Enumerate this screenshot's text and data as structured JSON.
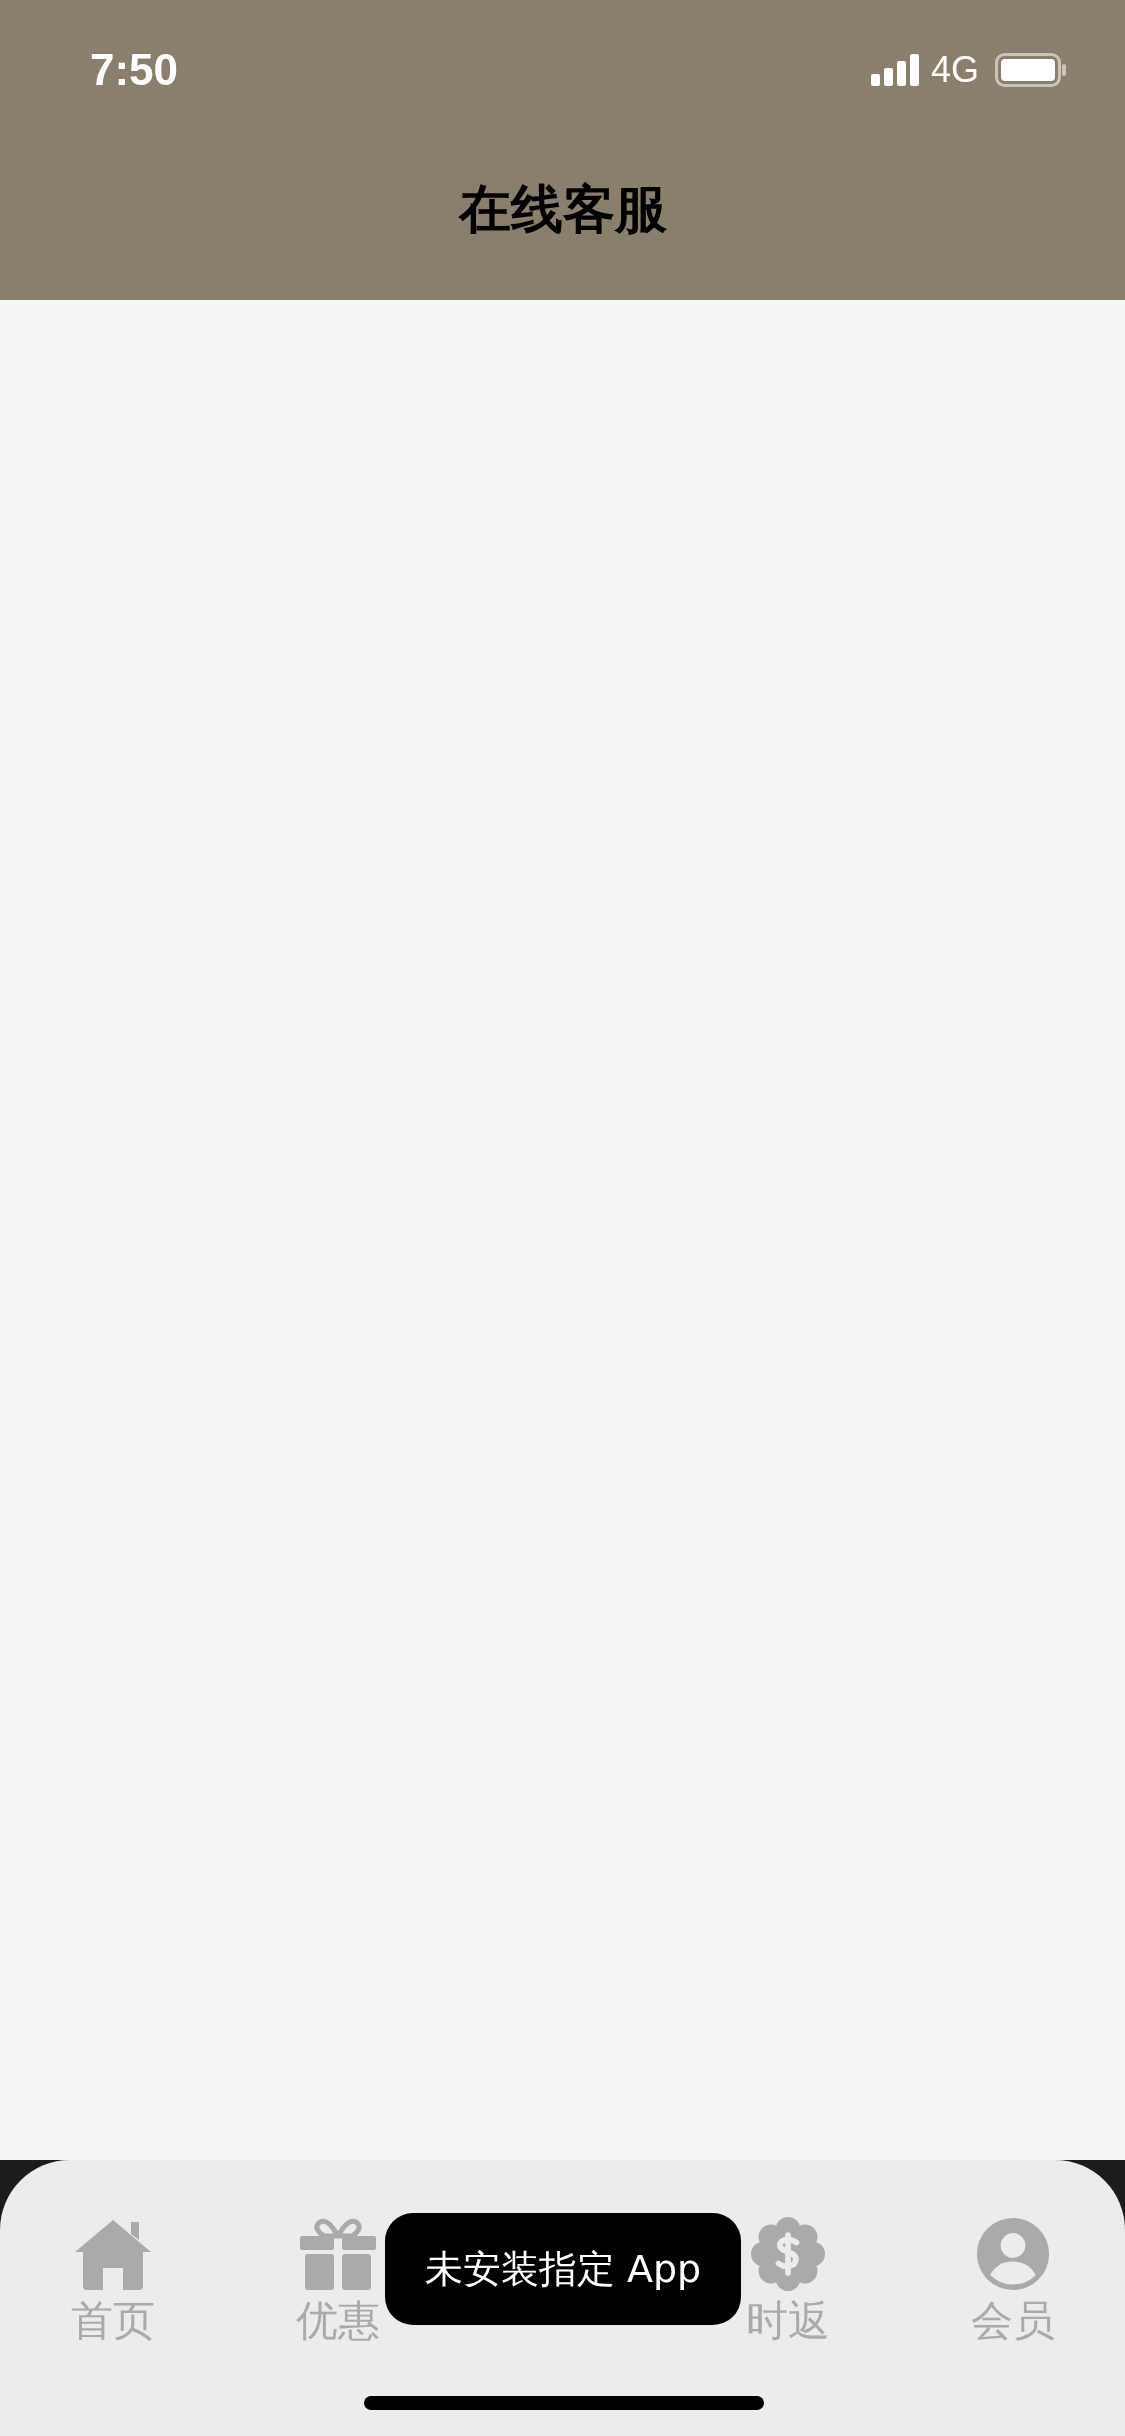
{
  "status_bar": {
    "time": "7:50",
    "network": "4G"
  },
  "header": {
    "title": "在线客服"
  },
  "tab_bar": {
    "tabs": [
      {
        "kind": "tab",
        "label": "首页"
      },
      {
        "kind": "tab",
        "label": "优惠"
      },
      {
        "kind": "covered"
      },
      {
        "kind": "tab",
        "label": "时返"
      },
      {
        "kind": "tab",
        "label": "会员"
      }
    ]
  },
  "toast": {
    "text": "未安装指定 App"
  }
}
